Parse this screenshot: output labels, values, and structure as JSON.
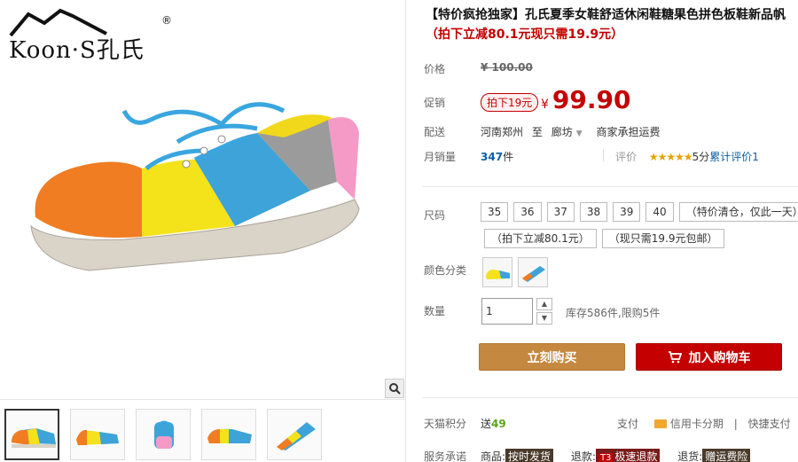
{
  "brand": {
    "logo_text": "Koon·S孔氏",
    "registered_mark": "®"
  },
  "gallery": {
    "thumbnails": [
      "thumb-1",
      "thumb-2",
      "thumb-3",
      "thumb-4",
      "thumb-5"
    ],
    "thumb_brand": "Koon·S孔氏"
  },
  "product": {
    "title": "【特价疯抢独家】孔氏夏季女鞋舒适休闲鞋糖果色拼色板鞋新品帆",
    "subtitle": "（拍下立减80.1元现只需19.9元）"
  },
  "price": {
    "label": "价格",
    "original": "¥ 100.00"
  },
  "promo": {
    "label": "促销",
    "tag": "拍下19元",
    "currency": "¥",
    "value": "99.90"
  },
  "delivery": {
    "label": "配送",
    "from": "河南郑州",
    "to_word": "至",
    "to": "廊坊",
    "shipping": "商家承担运费"
  },
  "sales": {
    "label": "月销量",
    "count": "347",
    "unit": "件",
    "review_label": "评价",
    "stars": "★★★★★",
    "score": "5分",
    "cumulative": "累计评价1"
  },
  "size": {
    "label": "尺码",
    "options": [
      "35",
      "36",
      "37",
      "38",
      "39",
      "40",
      "（特价清仓，仅此一天）"
    ],
    "options2": [
      "（拍下立减80.1元）",
      "（现只需19.9元包邮）"
    ]
  },
  "color": {
    "label": "颜色分类"
  },
  "quantity": {
    "label": "数量",
    "value": "1",
    "stock": "库存586件,限购5件"
  },
  "actions": {
    "buy_now": "立刻购买",
    "add_cart": "加入购物车"
  },
  "points": {
    "label": "天猫积分",
    "send": "送",
    "value": "49"
  },
  "payment": {
    "label": "支付",
    "card": "信用卡分期",
    "quick": "快捷支付"
  },
  "promise": {
    "label": "服务承诺",
    "goods": "商品:",
    "goods_chip": "按时发货",
    "refund": "退款:",
    "refund_badge": "T3",
    "refund_chip": "极速退款",
    "return": "退货:",
    "return_chip": "赠运费险"
  },
  "colors": {
    "accent_red": "#c40000",
    "buy_button": "#c58840",
    "link_blue": "#0b5fa5"
  }
}
